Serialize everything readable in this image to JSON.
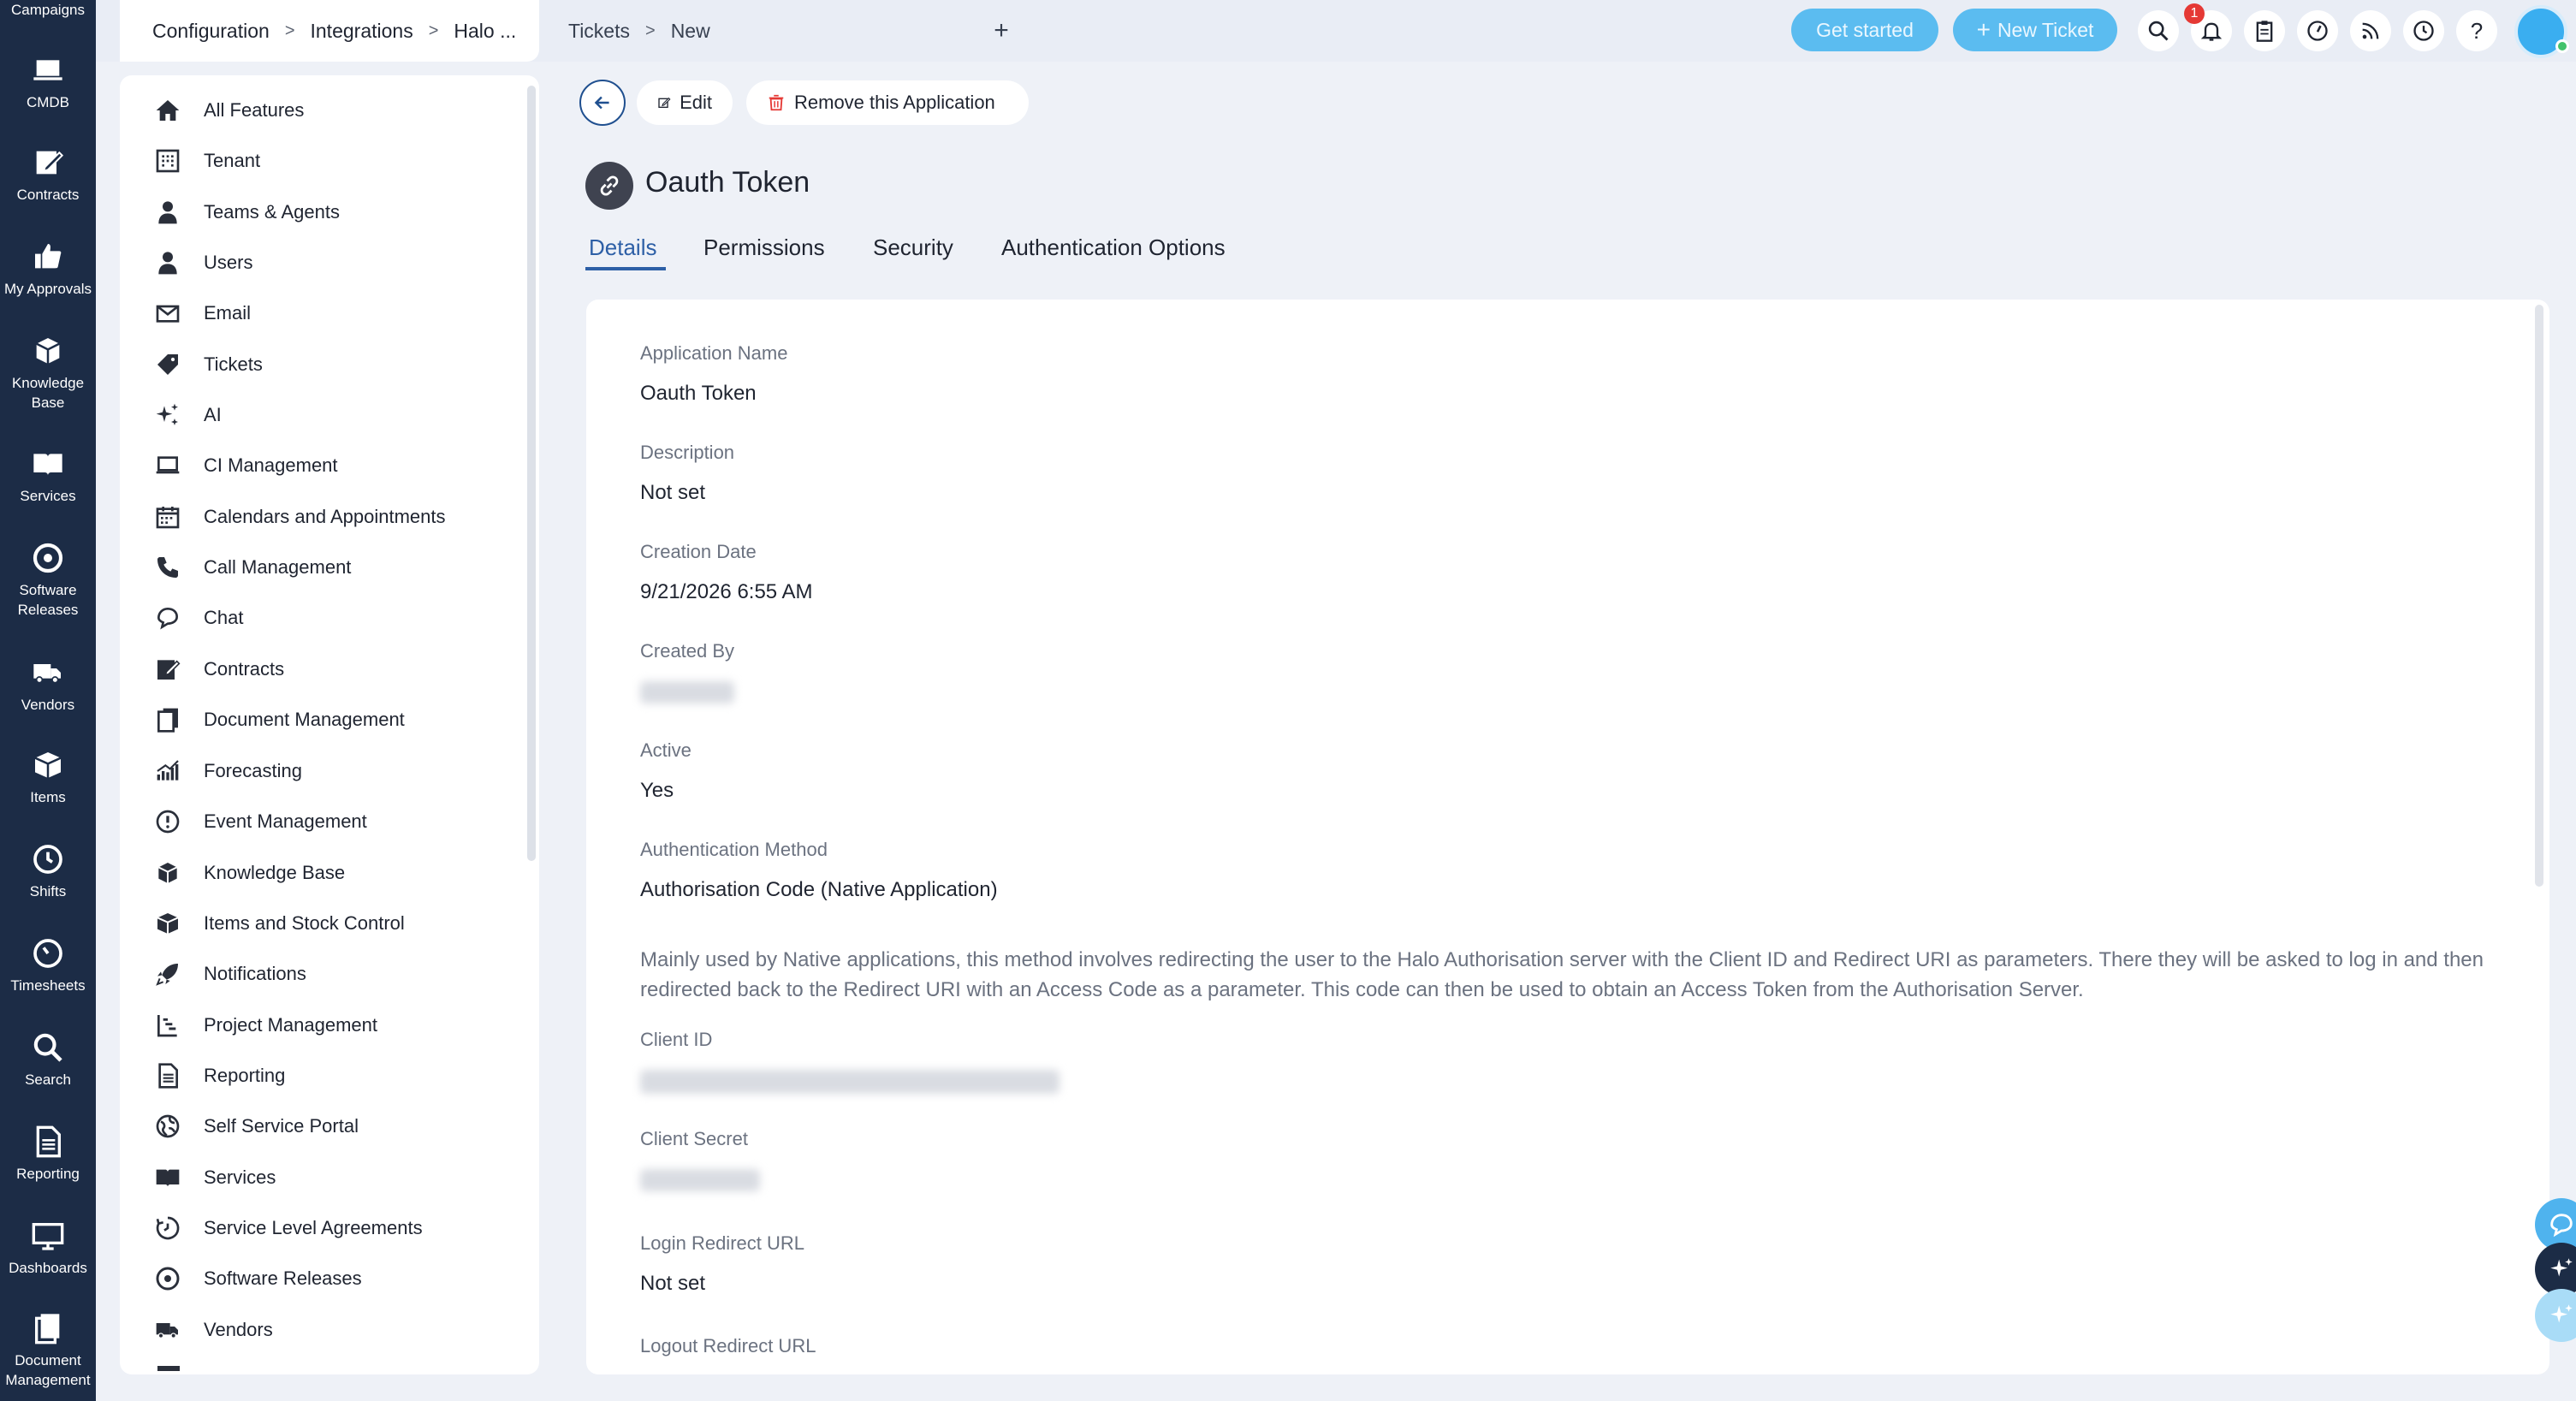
{
  "leftnav": {
    "top_label": "Campaigns",
    "items": [
      {
        "label": "CMDB",
        "icon": "laptop-icon"
      },
      {
        "label": "Contracts",
        "icon": "edit-contract-icon"
      },
      {
        "label": "My Approvals",
        "icon": "thumbs-up-icon"
      },
      {
        "label": "Knowledge\nBase",
        "icon": "cubes-icon"
      },
      {
        "label": "Services",
        "icon": "book-icon"
      },
      {
        "label": "Software\nReleases",
        "icon": "disc-icon"
      },
      {
        "label": "Vendors",
        "icon": "truck-icon"
      },
      {
        "label": "Items",
        "icon": "box-icon"
      },
      {
        "label": "Shifts",
        "icon": "clock-icon"
      },
      {
        "label": "Timesheets",
        "icon": "timer-icon"
      },
      {
        "label": "Search",
        "icon": "search-icon"
      },
      {
        "label": "Reporting",
        "icon": "report-icon"
      },
      {
        "label": "Dashboards",
        "icon": "monitor-icon"
      },
      {
        "label": "Document\nManagement",
        "icon": "documents-icon"
      }
    ]
  },
  "topbar": {
    "breadcrumb": [
      "Configuration",
      "Integrations",
      "Halo ..."
    ],
    "breadcrumb_sep": ">",
    "tab2": [
      "Tickets",
      "New"
    ],
    "add_tab": "+",
    "get_started": "Get started",
    "new_ticket": "New Ticket",
    "new_ticket_plus": "+",
    "notification_count": "1",
    "help": "?"
  },
  "features": {
    "items": [
      {
        "label": "All Features",
        "icon": "home-icon"
      },
      {
        "label": "Tenant",
        "icon": "building-icon"
      },
      {
        "label": "Teams & Agents",
        "icon": "agent-icon"
      },
      {
        "label": "Users",
        "icon": "user-icon"
      },
      {
        "label": "Email",
        "icon": "envelope-icon"
      },
      {
        "label": "Tickets",
        "icon": "ticket-icon"
      },
      {
        "label": "AI",
        "icon": "sparkle-icon"
      },
      {
        "label": "CI Management",
        "icon": "laptop-icon"
      },
      {
        "label": "Calendars and Appointments",
        "icon": "calendar-icon"
      },
      {
        "label": "Call Management",
        "icon": "phone-icon"
      },
      {
        "label": "Chat",
        "icon": "chat-icon"
      },
      {
        "label": "Contracts",
        "icon": "edit-contract-icon"
      },
      {
        "label": "Document Management",
        "icon": "documents-icon"
      },
      {
        "label": "Forecasting",
        "icon": "chart-icon"
      },
      {
        "label": "Event Management",
        "icon": "alert-icon"
      },
      {
        "label": "Knowledge Base",
        "icon": "cubes-icon"
      },
      {
        "label": "Items and Stock Control",
        "icon": "box-icon"
      },
      {
        "label": "Notifications",
        "icon": "rocket-icon"
      },
      {
        "label": "Project Management",
        "icon": "project-icon"
      },
      {
        "label": "Reporting",
        "icon": "report-icon"
      },
      {
        "label": "Self Service Portal",
        "icon": "globe-icon"
      },
      {
        "label": "Services",
        "icon": "book-icon"
      },
      {
        "label": "Service Level Agreements",
        "icon": "sla-icon"
      },
      {
        "label": "Software Releases",
        "icon": "disc-icon"
      },
      {
        "label": "Vendors",
        "icon": "truck-icon"
      }
    ]
  },
  "actions": {
    "edit": "Edit",
    "remove": "Remove this Application"
  },
  "page": {
    "title": "Oauth Token"
  },
  "tabs": [
    "Details",
    "Permissions",
    "Security",
    "Authentication Options"
  ],
  "details": {
    "application_name_label": "Application Name",
    "application_name": "Oauth Token",
    "description_label": "Description",
    "description": "Not set",
    "creation_date_label": "Creation Date",
    "creation_date": "9/21/2026 6:55 AM",
    "created_by_label": "Created By",
    "active_label": "Active",
    "active": "Yes",
    "auth_method_label": "Authentication Method",
    "auth_method": "Authorisation Code (Native Application)",
    "auth_method_description": "Mainly used by Native applications, this method involves redirecting the user to the Halo Authorisation server with the Client ID and Redirect URI as parameters. There they will be asked to log in and then redirected back to the Redirect URI with an Access Code as a parameter. This code can then be used to obtain an Access Token from the Authorisation Server.",
    "client_id_label": "Client ID",
    "client_secret_label": "Client Secret",
    "login_redirect_label": "Login Redirect URL",
    "login_redirect": "Not set",
    "logout_redirect_label": "Logout Redirect URL"
  },
  "colors": {
    "nav_bg": "#1c2c46",
    "accent": "#2d5fa6",
    "button_blue": "#5bbcf0",
    "badge_red": "#e53935"
  }
}
